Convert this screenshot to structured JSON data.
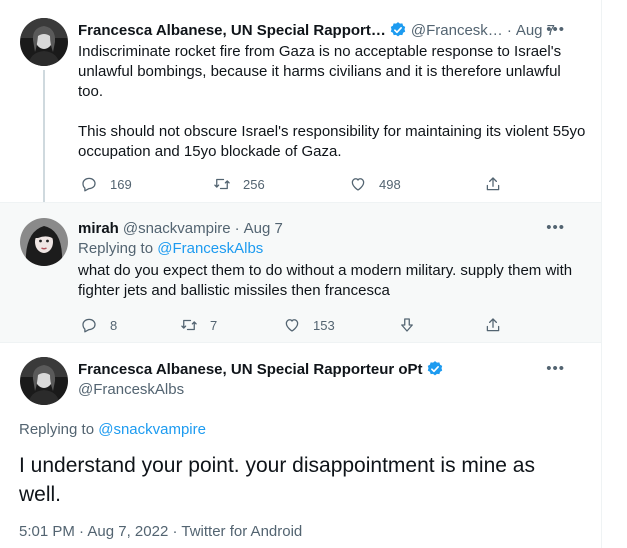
{
  "tweet1": {
    "author_name": "Francesca Albanese, UN Special Rapport…",
    "author_handle": "@Francesk…",
    "date": "Aug 7",
    "more": "•••",
    "text_p1": "Indiscriminate rocket fire from Gaza is no acceptable response to Israel's unlawful bombings, because it harms civilians and it is therefore unlawful too.",
    "text_p2": "This should not obscure Israel's responsibility for maintaining its violent 55yo occupation and 15yo blockade of Gaza.",
    "replies": "169",
    "retweets": "256",
    "likes": "498",
    "verified_color": "#1d9bf0"
  },
  "tweet2": {
    "author_name": "mirah",
    "author_handle": "@snackvampire",
    "date": "Aug 7",
    "more": "•••",
    "replying_prefix": "Replying to ",
    "replying_handle": "@FranceskAlbs",
    "text": "what do you expect them to do without a modern military. supply them with fighter jets and ballistic missiles then francesca",
    "replies": "8",
    "retweets": "7",
    "likes": "153"
  },
  "tweet3": {
    "author_name": "Francesca Albanese, UN Special Rapporteur oPt",
    "author_handle": "@FranceskAlbs",
    "more": "•••",
    "replying_prefix": "Replying to ",
    "replying_handle": "@snackvampire",
    "text": "I understand your point. your disappointment is mine as well.",
    "time": "5:01 PM",
    "full_date": "Aug 7, 2022",
    "source": "Twitter for Android"
  },
  "colors": {
    "accent": "#1d9bf0",
    "secondary_text": "#536471",
    "highlight_bg": "#f7f9f9"
  },
  "icons": [
    "reply-icon",
    "retweet-icon",
    "like-icon",
    "share-icon",
    "downvote-icon",
    "verified-icon",
    "more-icon"
  ]
}
